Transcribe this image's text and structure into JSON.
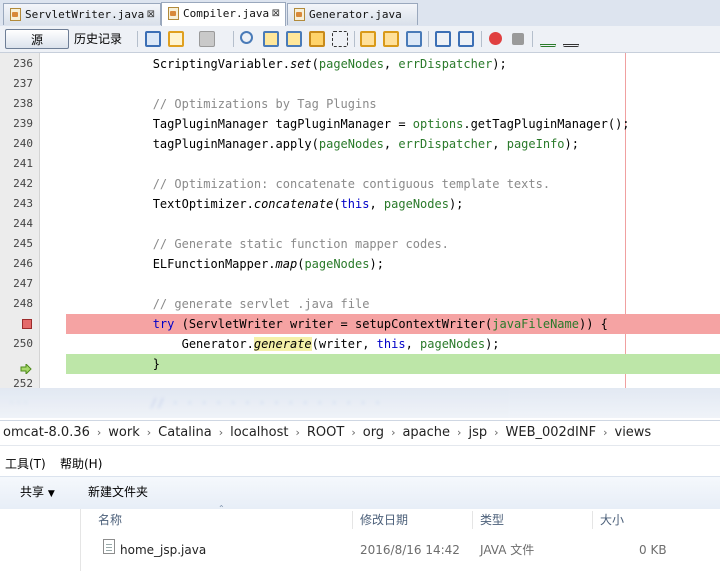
{
  "tabs": [
    {
      "label": "ServletWriter.java",
      "close": "⊠",
      "active": false
    },
    {
      "label": "Compiler.java",
      "close": "⊠",
      "active": true
    },
    {
      "label": "Generator.java",
      "close": "⊠",
      "active": false
    }
  ],
  "toolbar": {
    "source_label": "源",
    "history_label": "历史记录"
  },
  "editor": {
    "lines": [
      {
        "num": "236",
        "code": "            ScriptingVariabler.set(pageNodes, errDispatcher);",
        "kind": "normal"
      },
      {
        "num": "237",
        "code": "",
        "kind": "normal"
      },
      {
        "num": "238",
        "code": "            // Optimizations by Tag Plugins",
        "kind": "comment"
      },
      {
        "num": "239",
        "code": "            TagPluginManager tagPluginManager = options.getTagPluginManager();",
        "kind": "normal"
      },
      {
        "num": "240",
        "code": "            tagPluginManager.apply(pageNodes, errDispatcher, pageInfo);",
        "kind": "normal"
      },
      {
        "num": "241",
        "code": "",
        "kind": "normal"
      },
      {
        "num": "242",
        "code": "            // Optimization: concatenate contiguous template texts.",
        "kind": "comment"
      },
      {
        "num": "243",
        "code": "            TextOptimizer.concatenate(this, pageNodes);",
        "kind": "normal"
      },
      {
        "num": "244",
        "code": "",
        "kind": "normal"
      },
      {
        "num": "245",
        "code": "            // Generate static function mapper codes.",
        "kind": "comment"
      },
      {
        "num": "246",
        "code": "            ELFunctionMapper.map(pageNodes);",
        "kind": "normal"
      },
      {
        "num": "247",
        "code": "",
        "kind": "normal"
      },
      {
        "num": "248",
        "code": "            // generate servlet .java file",
        "kind": "comment"
      },
      {
        "num": "",
        "code": "            try (ServletWriter writer = setupContextWriter(javaFileName)) {",
        "kind": "breakpoint"
      },
      {
        "num": "250",
        "code": "                Generator.generate(writer, this, pageNodes);",
        "kind": "normal"
      },
      {
        "num": "",
        "code": "            }",
        "kind": "current"
      },
      {
        "num": "252",
        "code": "",
        "kind": "normal"
      }
    ]
  },
  "explorer": {
    "breadcrumb": [
      "omcat-8.0.36",
      "work",
      "Catalina",
      "localhost",
      "ROOT",
      "org",
      "apache",
      "jsp",
      "WEB_002dINF",
      "views"
    ],
    "menu": [
      "工具(T)",
      "帮助(H)"
    ],
    "commands": {
      "share": "共享",
      "new_folder": "新建文件夹"
    },
    "columns": {
      "name": "名称",
      "date": "修改日期",
      "type": "类型",
      "size": "大小"
    },
    "files": [
      {
        "name": "home_jsp.java",
        "date": "2016/8/16 14:42",
        "type": "JAVA 文件",
        "size": "0 KB"
      }
    ]
  }
}
